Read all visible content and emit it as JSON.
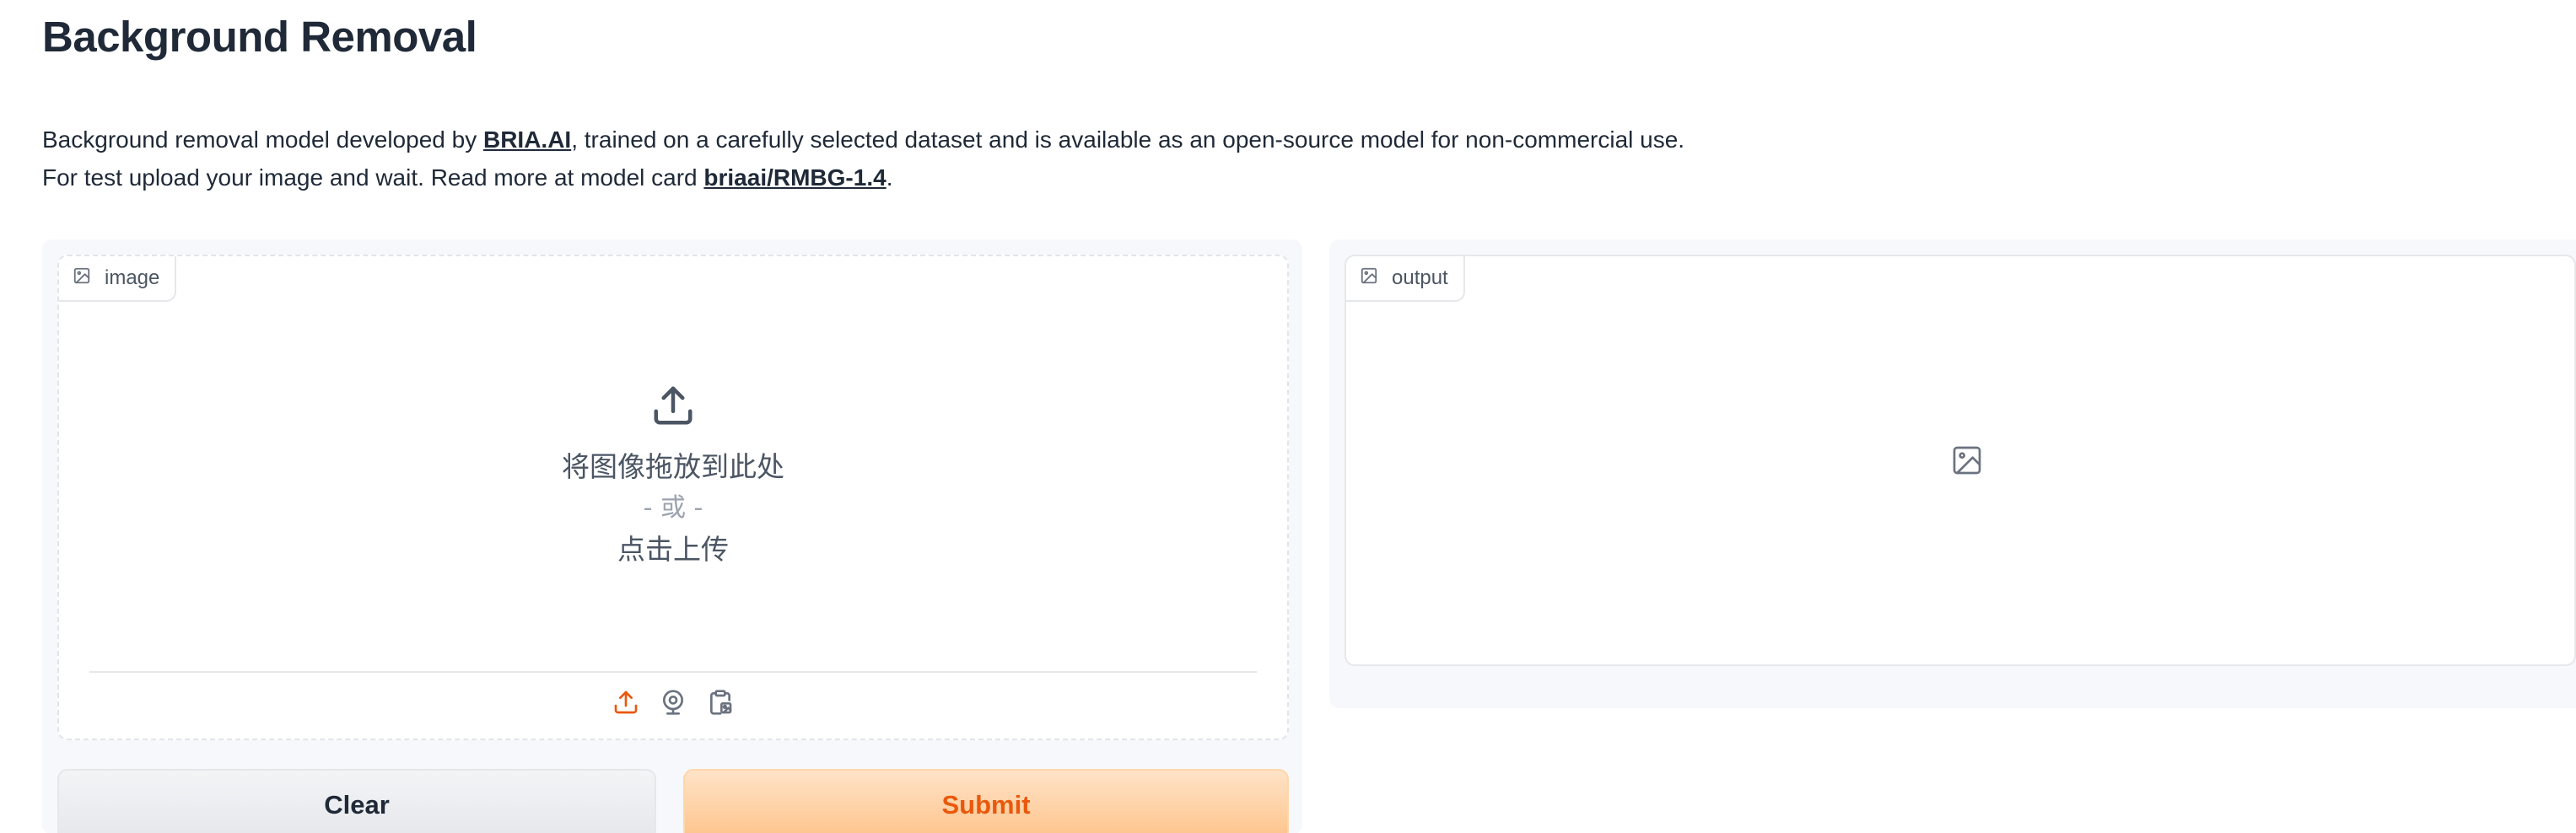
{
  "header": {
    "title": "Background Removal"
  },
  "description": {
    "line1_prefix": "Background removal model developed by ",
    "line1_link": "BRIA.AI",
    "line1_suffix": ", trained on a carefully selected dataset and is available as an open-source model for non-commercial use.",
    "line2_prefix": "For test upload your image and wait. Read more at model card ",
    "line2_link": "briaai/RMBG-1.4",
    "line2_suffix": "."
  },
  "input_panel": {
    "label": "image",
    "label_icon": "image-icon",
    "upload_icon": "upload-icon",
    "drop_text": "将图像拖放到此处",
    "or_text": "- 或 -",
    "click_text": "点击上传",
    "source_icons": [
      "upload-icon",
      "webcam-icon",
      "clipboard-icon"
    ],
    "active_color": "#ea580c"
  },
  "output_panel": {
    "label": "output",
    "label_icon": "image-icon",
    "placeholder_icon": "image-icon"
  },
  "actions": {
    "clear_label": "Clear",
    "submit_label": "Submit"
  },
  "colors": {
    "primary": "#ea580c",
    "panel_bg": "#f7f8fb",
    "text": "#1f2937"
  }
}
